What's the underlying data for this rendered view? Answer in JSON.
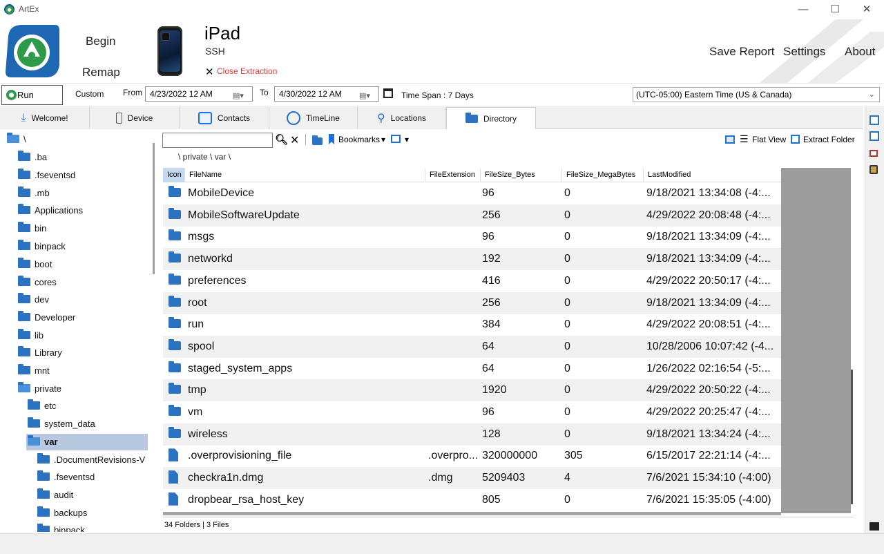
{
  "window": {
    "title": "ArtEx",
    "min": "—",
    "max": "☐",
    "close": "✕"
  },
  "header": {
    "begin": "Begin",
    "remap": "Remap",
    "device_name": "iPad",
    "device_conn": "SSH",
    "close_extraction": "Close Extraction",
    "save_report": "Save Report",
    "settings": "Settings",
    "about": "About"
  },
  "toolbar": {
    "run": "Run",
    "custom": "Custom",
    "from_label": "From",
    "from_value": "4/23/2022 12 AM",
    "to_label": "To",
    "to_value": "4/30/2022 12 AM",
    "timespan": "Time Span : 7 Days",
    "timezone": "(UTC-05:00) Eastern Time (US & Canada)"
  },
  "tabs": [
    {
      "label": "Welcome!",
      "icon": "download-icon"
    },
    {
      "label": "Device",
      "icon": "phone-icon"
    },
    {
      "label": "Contacts",
      "icon": "contact-card-icon"
    },
    {
      "label": "TimeLine",
      "icon": "clock-icon"
    },
    {
      "label": "Locations",
      "icon": "map-pin-icon"
    },
    {
      "label": "Directory",
      "icon": "folder-icon"
    }
  ],
  "tree": [
    {
      "label": "\\",
      "level": 0,
      "open": true
    },
    {
      "label": ".ba",
      "level": 1
    },
    {
      "label": ".fseventsd",
      "level": 1
    },
    {
      "label": ".mb",
      "level": 1
    },
    {
      "label": "Applications",
      "level": 1
    },
    {
      "label": "bin",
      "level": 1
    },
    {
      "label": "binpack",
      "level": 1
    },
    {
      "label": "boot",
      "level": 1
    },
    {
      "label": "cores",
      "level": 1
    },
    {
      "label": "dev",
      "level": 1
    },
    {
      "label": "Developer",
      "level": 1
    },
    {
      "label": "lib",
      "level": 1
    },
    {
      "label": "Library",
      "level": 1
    },
    {
      "label": "mnt",
      "level": 1
    },
    {
      "label": "private",
      "level": 1,
      "open": true
    },
    {
      "label": "etc",
      "level": 2
    },
    {
      "label": "system_data",
      "level": 2
    },
    {
      "label": "var",
      "level": 2,
      "open": true,
      "selected": true
    },
    {
      "label": ".DocumentRevisions-V",
      "level": 3
    },
    {
      "label": ".fseventsd",
      "level": 3
    },
    {
      "label": "audit",
      "level": 3
    },
    {
      "label": "backups",
      "level": 3
    },
    {
      "label": "binpack",
      "level": 3
    }
  ],
  "panel": {
    "bookmarks": "Bookmarks",
    "flat_view": "Flat View",
    "extract_folder": "Extract Folder",
    "breadcrumb": "\\  private  \\  var  \\",
    "status": "34 Folders | 3 Files"
  },
  "columns": [
    "Icon",
    "FileName",
    "FileExtension",
    "FileSize_Bytes",
    "FileSize_MegaBytes",
    "LastModified"
  ],
  "rows": [
    {
      "type": "folder",
      "name": "MobileDevice",
      "ext": "",
      "bytes": "96",
      "mb": "0",
      "modified": "9/18/2021   13:34:08 (-4:..."
    },
    {
      "type": "folder",
      "name": "MobileSoftwareUpdate",
      "ext": "",
      "bytes": "256",
      "mb": "0",
      "modified": "4/29/2022   20:08:48 (-4:..."
    },
    {
      "type": "folder",
      "name": "msgs",
      "ext": "",
      "bytes": "96",
      "mb": "0",
      "modified": "9/18/2021   13:34:09 (-4:..."
    },
    {
      "type": "folder",
      "name": "networkd",
      "ext": "",
      "bytes": "192",
      "mb": "0",
      "modified": "9/18/2021   13:34:09 (-4:..."
    },
    {
      "type": "folder",
      "name": "preferences",
      "ext": "",
      "bytes": "416",
      "mb": "0",
      "modified": "4/29/2022   20:50:17 (-4:..."
    },
    {
      "type": "folder",
      "name": "root",
      "ext": "",
      "bytes": "256",
      "mb": "0",
      "modified": "9/18/2021   13:34:09 (-4:..."
    },
    {
      "type": "folder",
      "name": "run",
      "ext": "",
      "bytes": "384",
      "mb": "0",
      "modified": "4/29/2022   20:08:51 (-4:..."
    },
    {
      "type": "folder",
      "name": "spool",
      "ext": "",
      "bytes": "64",
      "mb": "0",
      "modified": "10/28/2006   10:07:42 (-4..."
    },
    {
      "type": "folder",
      "name": "staged_system_apps",
      "ext": "",
      "bytes": "64",
      "mb": "0",
      "modified": "1/26/2022   02:16:54 (-5:..."
    },
    {
      "type": "folder",
      "name": "tmp",
      "ext": "",
      "bytes": "1920",
      "mb": "0",
      "modified": "4/29/2022   20:50:22 (-4:..."
    },
    {
      "type": "folder",
      "name": "vm",
      "ext": "",
      "bytes": "96",
      "mb": "0",
      "modified": "4/29/2022   20:25:47 (-4:..."
    },
    {
      "type": "folder",
      "name": "wireless",
      "ext": "",
      "bytes": "128",
      "mb": "0",
      "modified": "9/18/2021   13:34:24 (-4:..."
    },
    {
      "type": "file",
      "name": ".overprovisioning_file",
      "ext": ".overpro...",
      "bytes": "320000000",
      "mb": "305",
      "modified": "6/15/2017   22:21:14 (-4:..."
    },
    {
      "type": "file",
      "name": "checkra1n.dmg",
      "ext": ".dmg",
      "bytes": "5209403",
      "mb": "4",
      "modified": "7/6/2021   15:34:10 (-4:00)"
    },
    {
      "type": "file",
      "name": "dropbear_rsa_host_key",
      "ext": "",
      "bytes": "805",
      "mb": "0",
      "modified": "7/6/2021   15:35:05 (-4:00)"
    }
  ]
}
